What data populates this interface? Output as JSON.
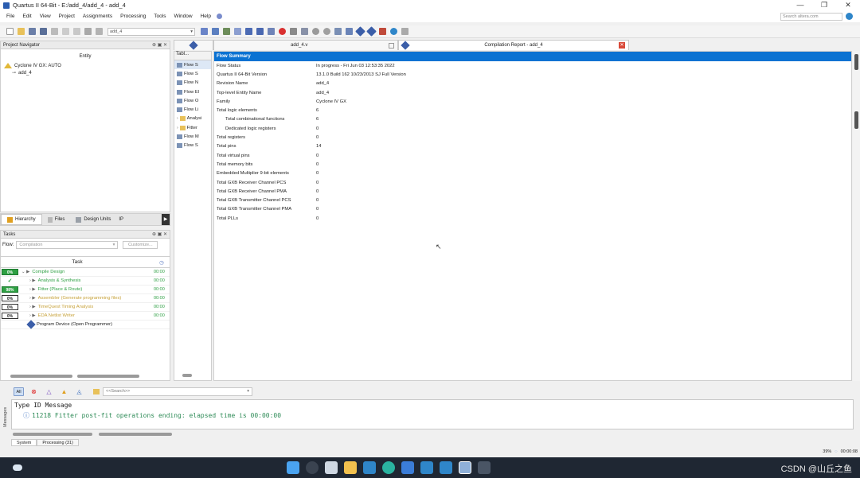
{
  "window": {
    "title": "Quartus II 64-Bit - E:/add_4/add_4 - add_4",
    "minimize": "—",
    "maximize": "❐",
    "close": "✕"
  },
  "menu": [
    "File",
    "Edit",
    "View",
    "Project",
    "Assignments",
    "Processing",
    "Tools",
    "Window",
    "Help"
  ],
  "search_placeholder": "Search altera.com",
  "toolbar": {
    "entity_select": "add_4"
  },
  "project_navigator": {
    "title": "Project Navigator",
    "column": "Entity",
    "device": "Cyclone IV GX: AUTO",
    "top_entity": "add_4"
  },
  "navigator_tabs": [
    "Hierarchy",
    "Files",
    "Design Units",
    "IP"
  ],
  "tasks": {
    "title": "Tasks",
    "flow_label": "Flow:",
    "flow_value": "Compilation",
    "customize_label": "Customize...",
    "column_task": "Task",
    "rows": [
      {
        "progress": "0%",
        "name": "Compile Design",
        "time": "00:00",
        "status": "pct-green"
      },
      {
        "progress": "✓",
        "name": "Analysis & Synthesis",
        "time": "00:00",
        "status": "check"
      },
      {
        "progress": "98%",
        "name": "Fitter (Place & Route)",
        "time": "00:00",
        "status": "pct-green"
      },
      {
        "progress": "0%",
        "name": "Assembler (Generate programming files)",
        "time": "00:00",
        "status": "pct"
      },
      {
        "progress": "0%",
        "name": "TimeQuest Timing Analysis",
        "time": "00:00",
        "status": "pct"
      },
      {
        "progress": "0%",
        "name": "EDA Netlist Writer",
        "time": "00:00",
        "status": "pct"
      },
      {
        "progress": "",
        "name": "Program Device (Open Programmer)",
        "time": "",
        "status": "none"
      }
    ]
  },
  "report_tabs": {
    "file_tab": "add_4.v",
    "report_tab": "Compilation Report - add_4"
  },
  "toc": {
    "header": "Tabl...",
    "items": [
      "Flow S",
      "Flow S",
      "Flow N",
      "Flow El",
      "Flow O",
      "Flow Li",
      "Analysi",
      "Fitter",
      "Flow M",
      "Flow S"
    ]
  },
  "flow_summary": {
    "title": "Flow Summary",
    "rows": [
      {
        "key": "Flow Status",
        "value": "In progress - Fri Jun 03 12:53:35 2022",
        "indent": false
      },
      {
        "key": "Quartus II 64-Bit Version",
        "value": "13.1.0 Build 162 10/23/2013 SJ Full Version",
        "indent": false
      },
      {
        "key": "Revision Name",
        "value": "add_4",
        "indent": false
      },
      {
        "key": "Top-level Entity Name",
        "value": "add_4",
        "indent": false
      },
      {
        "key": "Family",
        "value": "Cyclone IV GX",
        "indent": false
      },
      {
        "key": "Total logic elements",
        "value": "6",
        "indent": false
      },
      {
        "key": "Total combinational functions",
        "value": "6",
        "indent": true
      },
      {
        "key": "Dedicated logic registers",
        "value": "0",
        "indent": true
      },
      {
        "key": "Total registers",
        "value": "0",
        "indent": false
      },
      {
        "key": "Total pins",
        "value": "14",
        "indent": false
      },
      {
        "key": "Total virtual pins",
        "value": "0",
        "indent": false
      },
      {
        "key": "Total memory bits",
        "value": "0",
        "indent": false
      },
      {
        "key": "Embedded Multiplier 9-bit elements",
        "value": "0",
        "indent": false
      },
      {
        "key": "Total GXB Receiver Channel PCS",
        "value": "0",
        "indent": false
      },
      {
        "key": "Total GXB Receiver Channel PMA",
        "value": "0",
        "indent": false
      },
      {
        "key": "Total GXB Transmitter Channel PCS",
        "value": "0",
        "indent": false
      },
      {
        "key": "Total GXB Transmitter Channel PMA",
        "value": "0",
        "indent": false
      },
      {
        "key": "Total PLLs",
        "value": "0",
        "indent": false
      }
    ]
  },
  "messages": {
    "filter_all": "All",
    "search_placeholder": "<<Search>>",
    "header": "Type  ID   Message",
    "line": "11218 Fitter post-fit operations ending: elapsed time is 00:00:00",
    "side_label": "Messages",
    "tabs": [
      "System",
      "Processing (31)"
    ]
  },
  "status": {
    "progress": "39%",
    "time": "00:00:08"
  },
  "watermark": "CSDN @山丘之鱼"
}
